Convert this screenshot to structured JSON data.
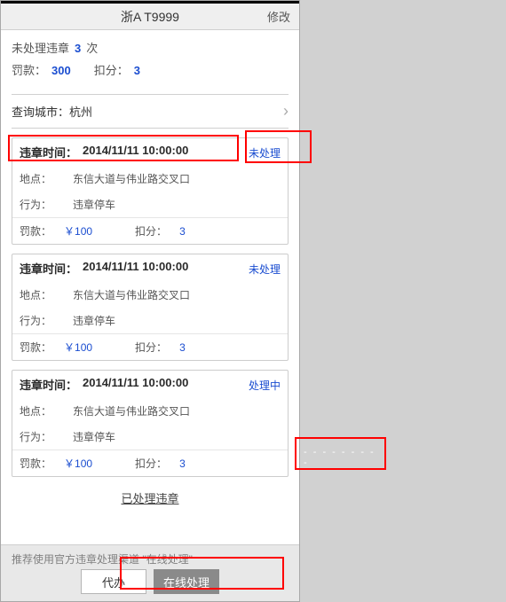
{
  "header": {
    "title": "浙A T9999",
    "edit_label": "修改"
  },
  "summary": {
    "unprocessed_label": "未处理违章",
    "unprocessed_count": "3",
    "count_unit": "次",
    "fine_label": "罚款：",
    "fine_value": "300",
    "points_label": "扣分：",
    "points_value": "3"
  },
  "city": {
    "label": "查询城市：",
    "value": "杭州"
  },
  "violations": [
    {
      "time_label": "违章时间：",
      "time_value": "2014/11/11  10:00:00",
      "status": "未处理",
      "loc_label": "地点：",
      "loc_value": "东信大道与伟业路交叉口",
      "beh_label": "行为：",
      "beh_value": "违章停车",
      "fine_label": "罚款：",
      "fine_value": "￥100",
      "pts_label": "扣分：",
      "pts_value": "3"
    },
    {
      "time_label": "违章时间：",
      "time_value": "2014/11/11  10:00:00",
      "status": "未处理",
      "loc_label": "地点：",
      "loc_value": "东信大道与伟业路交叉口",
      "beh_label": "行为：",
      "beh_value": "违章停车",
      "fine_label": "罚款：",
      "fine_value": "￥100",
      "pts_label": "扣分：",
      "pts_value": "3"
    },
    {
      "time_label": "违章时间：",
      "time_value": "2014/11/11  10:00:00",
      "status": "处理中",
      "loc_label": "地点：",
      "loc_value": "东信大道与伟业路交叉口",
      "beh_label": "行为：",
      "beh_value": "违章停车",
      "fine_label": "罚款：",
      "fine_value": "￥100",
      "pts_label": "扣分：",
      "pts_value": "3"
    }
  ],
  "processed_link": "已处理违章",
  "bottom": {
    "tip": "推荐使用官方违章处理渠道 \"在线处理\"",
    "agent_label": "代办",
    "online_label": "在线处理"
  },
  "dashed_text": "- - - - - - - - -"
}
